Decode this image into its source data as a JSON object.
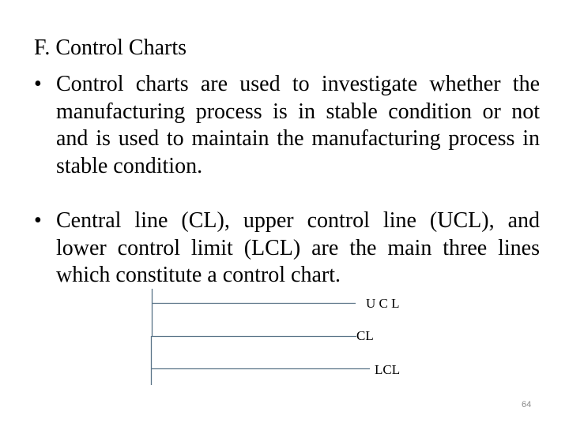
{
  "slide": {
    "title": "F. Control Charts",
    "bullets": [
      {
        "marker": "•",
        "text": "Control charts  are used to investigate whether the manufacturing process is in stable condition or not and is used to maintain the manufacturing process in stable condition."
      },
      {
        "marker": "•",
        "text": "Central line (CL), upper control line (UCL), and lower control limit (LCL) are the main three lines which constitute a control chart."
      }
    ],
    "diagram": {
      "line_color": "#5a7488",
      "lines": [
        {
          "id": "ucl",
          "label": "U C L"
        },
        {
          "id": "cl",
          "label": "CL"
        },
        {
          "id": "lcl",
          "label": "LCL"
        }
      ]
    },
    "page_number": "64"
  }
}
